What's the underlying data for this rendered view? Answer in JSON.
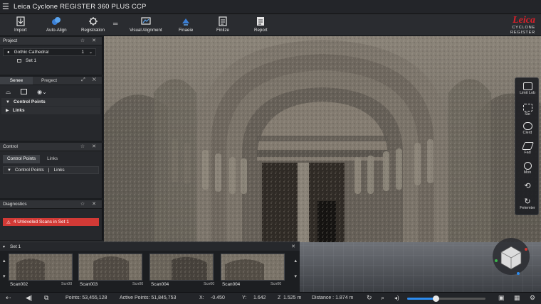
{
  "app": {
    "title": "Leica Cyclone REGISTER 360 PLUS CCP"
  },
  "brand": {
    "logo": "Leica",
    "line1": "CYCLONE",
    "line2": "REGISTER"
  },
  "ribbon": [
    {
      "label": "Import",
      "icon": "import-icon"
    },
    {
      "label": "Auto-Align",
      "icon": "auto-align-icon"
    },
    {
      "label": "Registration",
      "icon": "registration-icon"
    },
    {
      "label": "Visual Alignment",
      "icon": "visual-alignment-icon"
    },
    {
      "label": "Finaeie",
      "icon": "finalize-icon"
    },
    {
      "label": "Finlize",
      "icon": "finlize-icon"
    },
    {
      "label": "Report",
      "icon": "report-icon"
    }
  ],
  "project_panel": {
    "title": "Project",
    "item": "Gothic Cathedral",
    "count": "1",
    "subitem": "Set 1"
  },
  "tabs_panel": {
    "tabs": [
      "Senee",
      "Pregect"
    ],
    "items": [
      "Control Points",
      "Links"
    ]
  },
  "control_panel": {
    "title": "Control",
    "tabs": [
      "Control Points",
      "Links"
    ],
    "row": [
      "Control Points",
      "Links"
    ]
  },
  "diagnostics_panel": {
    "title": "Diagnostics",
    "alert": "4 Unleveled Scans in Set 1",
    "alert_color": "#d23a36"
  },
  "set_strip": {
    "title": "Set 1",
    "scans": [
      {
        "name": "Scan002",
        "tag": "Scn00"
      },
      {
        "name": "Scan003",
        "tag": "Scn00"
      },
      {
        "name": "Scan004",
        "tag": "Scn00"
      },
      {
        "name": "Scan004",
        "tag": "Scn00"
      }
    ]
  },
  "right_tools": [
    {
      "label": "Limit Lob",
      "icon": "limit-box-icon"
    },
    {
      "label": "Sie",
      "icon": "site-icon"
    },
    {
      "label": "Clerd",
      "icon": "cloud-icon"
    },
    {
      "label": "Fad",
      "icon": "layers-icon"
    },
    {
      "label": "Mon",
      "icon": "zoom-icon"
    },
    {
      "label": "",
      "icon": "orbit-icon"
    },
    {
      "label": "Fetemter",
      "icon": "reset-icon"
    }
  ],
  "status": {
    "points": "Points: 53,455,128",
    "active_points": "Active Points: 51,845,753",
    "x_label": "X:",
    "x": "-0.450",
    "y_label": "Y:",
    "y": "1.642",
    "z_label": "Z",
    "z": "1.525 m",
    "distance": "Distance : 1.874 m",
    "point_size": 0.36
  },
  "colors": {
    "accent": "#2d8cf0",
    "alert": "#d23a36",
    "brand": "#d8202a"
  }
}
